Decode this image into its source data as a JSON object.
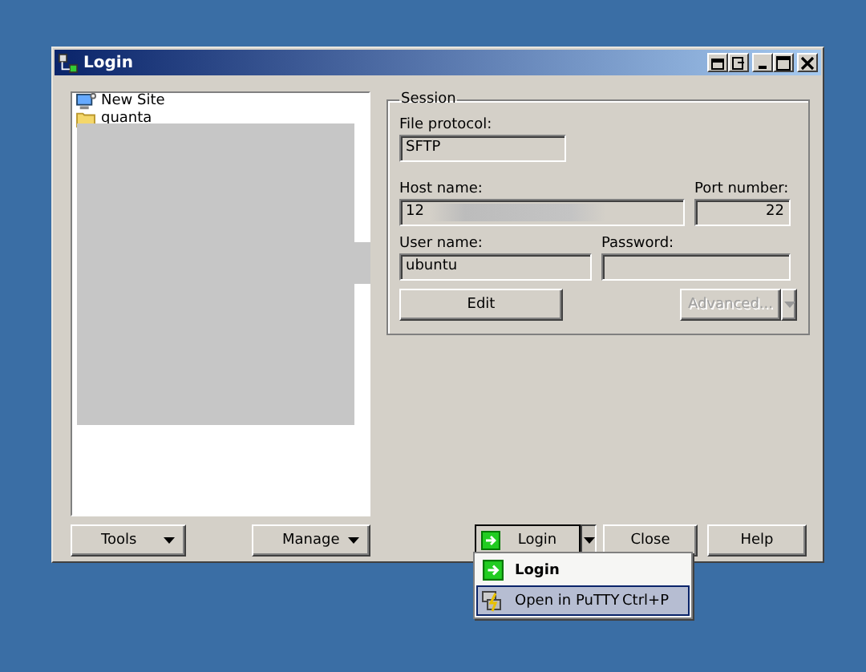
{
  "window": {
    "title": "Login"
  },
  "sites": [
    {
      "label": "New Site",
      "kind": "site"
    },
    {
      "label": "quanta",
      "kind": "folder"
    }
  ],
  "session": {
    "title": "Session",
    "file_protocol": {
      "label": "File protocol:",
      "value": "SFTP"
    },
    "host_name": {
      "label": "Host name:",
      "value": "12"
    },
    "port_number": {
      "label": "Port number:",
      "value": "22"
    },
    "user_name": {
      "label": "User name:",
      "value": "ubuntu"
    },
    "password": {
      "label": "Password:"
    },
    "edit_button": {
      "label": "Edit",
      "disabled": false
    },
    "advanced_button": {
      "label": "Advanced...",
      "disabled": true
    }
  },
  "buttons": [
    {
      "label": "Tools",
      "kind": "dropdown"
    },
    {
      "label": "Manage",
      "kind": "dropdown"
    },
    {
      "label": "Login",
      "kind": "split"
    },
    {
      "label": "Close",
      "kind": "plain"
    },
    {
      "label": "Help",
      "kind": "plain"
    }
  ],
  "login_menu": [
    {
      "label": "Login",
      "kind": "login",
      "default": true,
      "selected": false
    },
    {
      "label": "Open in PuTTY",
      "shortcut": "Ctrl+P",
      "kind": "putty",
      "default": false,
      "selected": true
    }
  ]
}
